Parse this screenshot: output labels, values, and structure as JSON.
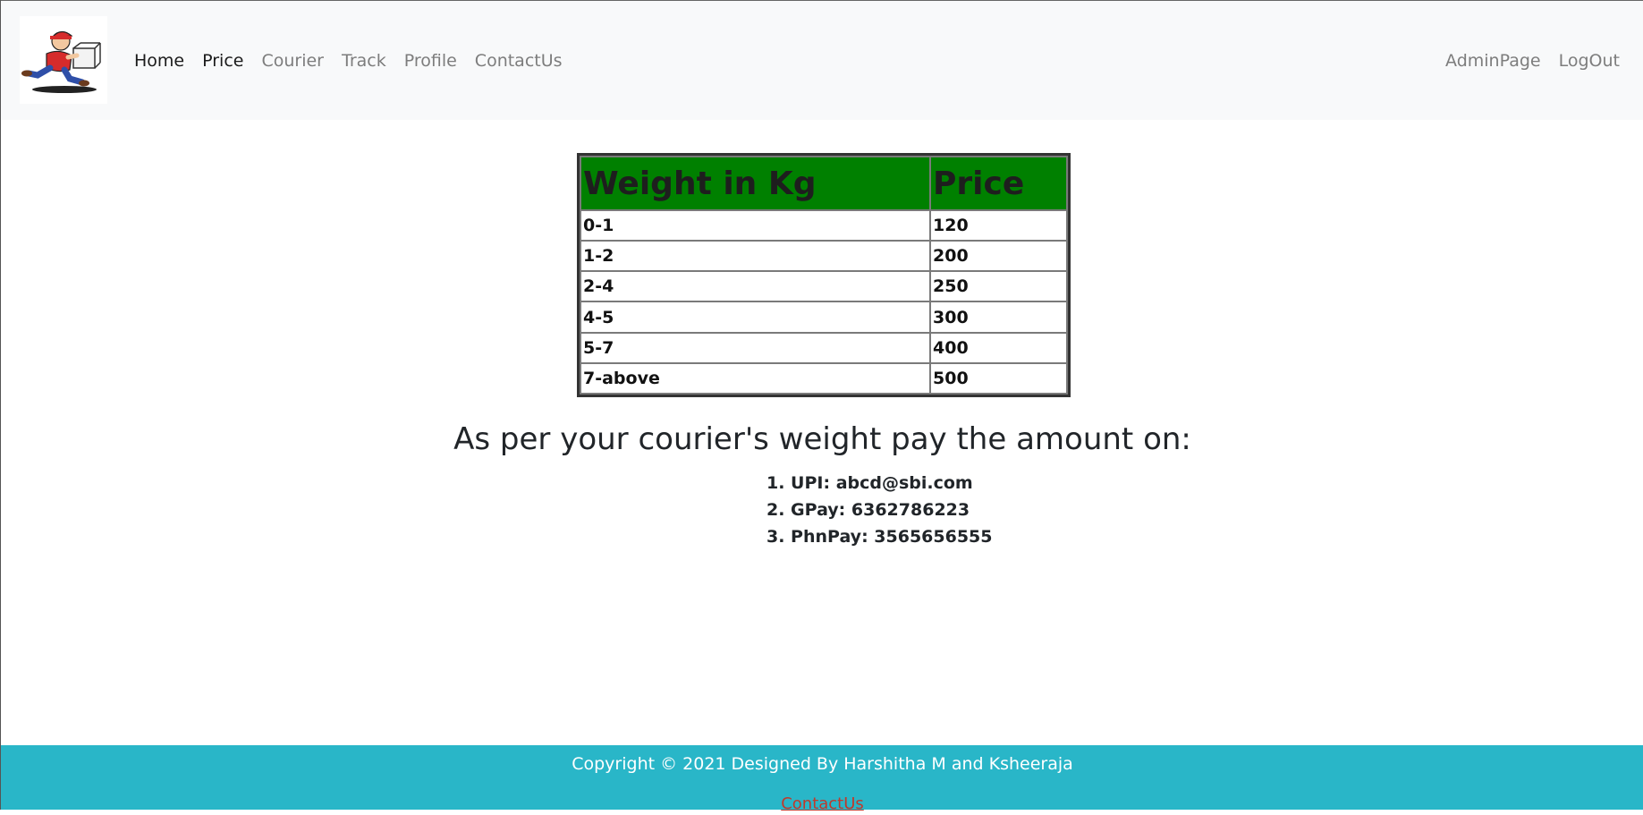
{
  "nav": {
    "logo_alt": "courier delivery man logo",
    "left_items": [
      {
        "label": "Home",
        "active": true
      },
      {
        "label": "Price",
        "active": true
      },
      {
        "label": "Courier",
        "active": false
      },
      {
        "label": "Track",
        "active": false
      },
      {
        "label": "Profile",
        "active": false
      },
      {
        "label": "ContactUs",
        "active": false
      }
    ],
    "right_items": [
      {
        "label": "AdminPage"
      },
      {
        "label": "LogOut"
      }
    ]
  },
  "price_table": {
    "headers": [
      "Weight in Kg",
      "Price"
    ],
    "rows": [
      [
        "0-1",
        "120"
      ],
      [
        "1-2",
        "200"
      ],
      [
        "2-4",
        "250"
      ],
      [
        "4-5",
        "300"
      ],
      [
        "5-7",
        "400"
      ],
      [
        "7-above",
        "500"
      ]
    ],
    "header_color": "#008000"
  },
  "payment": {
    "heading": "As per your courier's weight pay the amount on:",
    "methods": [
      "1. UPI: abcd@sbi.com",
      "2. GPay: 6362786223",
      "3. PhnPay: 3565656555"
    ]
  },
  "footer": {
    "copyright": "Copyright © 2021 Designed By Harshitha M and Ksheeraja",
    "contact_link": "ContactUs",
    "background": "#29b6c8"
  }
}
